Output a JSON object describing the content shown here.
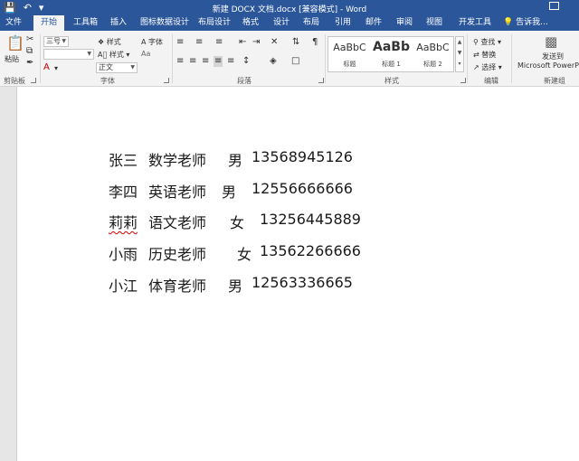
{
  "title_bar": {
    "save_icon": "save-icon",
    "undo_icon": "undo-icon",
    "customize_icon": "customize-qat-icon",
    "title": "新建 DOCX 文档.docx [兼容模式] - Word"
  },
  "tabs": [
    {
      "label": "文件"
    },
    {
      "label": "开始"
    },
    {
      "label": "工具箱"
    },
    {
      "label": "插入"
    },
    {
      "label": "图标数据设计"
    },
    {
      "label": "布局设计"
    },
    {
      "label": "格式"
    },
    {
      "label": "设计"
    },
    {
      "label": "布局"
    },
    {
      "label": "引用"
    },
    {
      "label": "邮件"
    },
    {
      "label": "审阅"
    },
    {
      "label": "视图"
    },
    {
      "label": "开发工具"
    }
  ],
  "tell_me": "告诉我...",
  "ribbon": {
    "clipboard": {
      "label": "剪贴板",
      "paste": "粘贴"
    },
    "font": {
      "label": "字体",
      "font_size": "三号",
      "font_name": "",
      "style_name": "正文",
      "style_btn": "样式",
      "style_btn2": "样式",
      "font_btn": "字体"
    },
    "paragraph": {
      "label": "段落"
    },
    "styles": {
      "label": "样式",
      "items": [
        {
          "sample": "AaBbC",
          "name": "标题"
        },
        {
          "sample": "AaBb",
          "name": "标题 1"
        },
        {
          "sample": "AaBbC",
          "name": "标题 2"
        }
      ]
    },
    "editing": {
      "label": "编辑",
      "find": "查找",
      "replace": "替换",
      "select": "选择"
    },
    "new_group": {
      "label": "新建组",
      "send_line1": "发送到",
      "send_line2": "Microsoft PowerPoint"
    }
  },
  "document": {
    "lines": [
      {
        "name": "张三",
        "subject": "数学老师",
        "gender": "男",
        "phone": "13568945126"
      },
      {
        "name": "李四",
        "subject": "英语老师",
        "gender": "男",
        "phone": "12556666666"
      },
      {
        "name": "莉莉",
        "subject": "语文老师",
        "gender": "女",
        "phone": "13256445889"
      },
      {
        "name": "小雨",
        "subject": "历史老师",
        "gender": "女",
        "phone": "13562266666"
      },
      {
        "name": "小江",
        "subject": "体育老师",
        "gender": "男",
        "phone": "12563336665"
      }
    ]
  }
}
